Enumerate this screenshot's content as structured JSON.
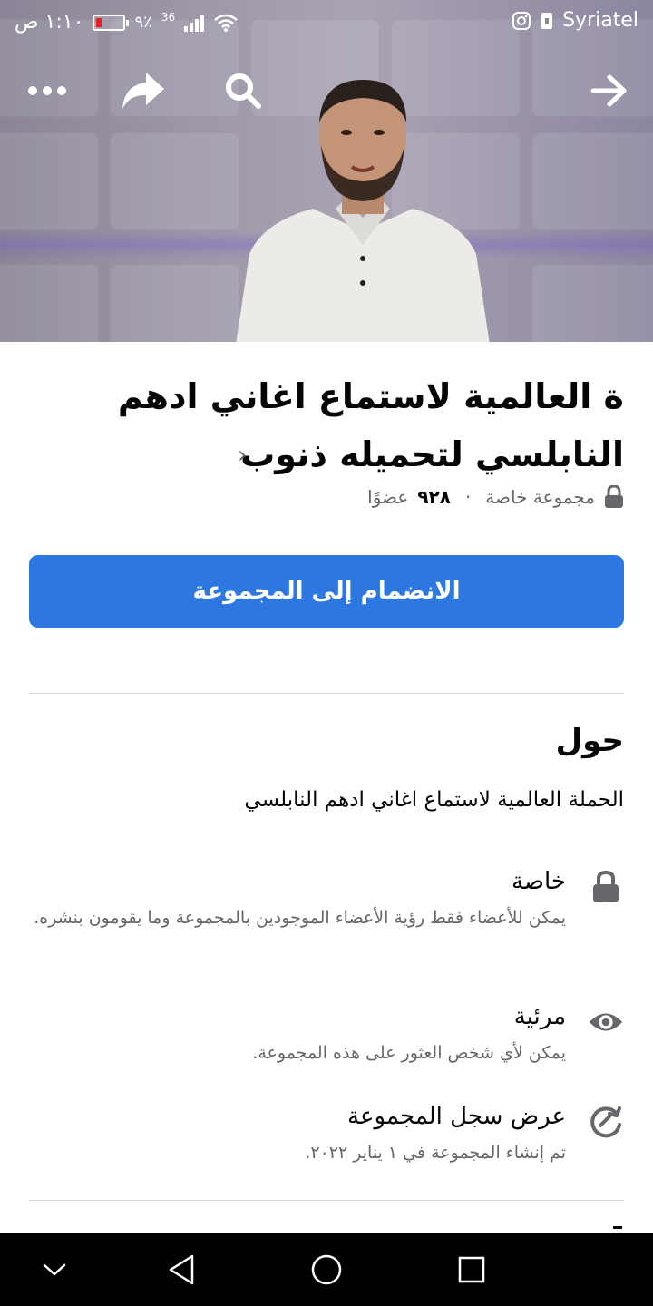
{
  "status_bar": {
    "time": "١:١٠ ص",
    "battery_percent": "٩٪",
    "network_badge": "36",
    "carrier": "Syriatel"
  },
  "cover": {
    "icons": [
      "more-icon",
      "share-icon",
      "search-icon",
      "forward-arrow-icon"
    ]
  },
  "group": {
    "title": "ة العالمية لاستماع اغاني ادهم النابلسي لتحميله ذنوب",
    "privacy_label": "مجموعة خاصة",
    "separator": "·",
    "members_count": "٩٢٨",
    "members_label": "عضوًا"
  },
  "join_button": {
    "label": "الانضمام إلى المجموعة"
  },
  "about": {
    "title": "حول",
    "description": "الحملة العالمية لاستماع اغاني ادهم النابلسي",
    "items": [
      {
        "icon": "lock-icon",
        "heading": "خاصة",
        "sub": "يمكن للأعضاء فقط رؤية الأعضاء الموجودين بالمجموعة وما يقومون بنشره."
      },
      {
        "icon": "eye-icon",
        "heading": "مرئية",
        "sub": "يمكن لأي شخص العثور على هذه المجموعة."
      },
      {
        "icon": "history-icon",
        "heading": "عرض سجل المجموعة",
        "sub": "تم إنشاء المجموعة في ١ يناير ٢٠٢٢."
      }
    ]
  },
  "colors": {
    "accent": "#2d78e0",
    "secondary_text": "#65676b",
    "divider": "#dadde1",
    "battery_low": "#e62020"
  }
}
